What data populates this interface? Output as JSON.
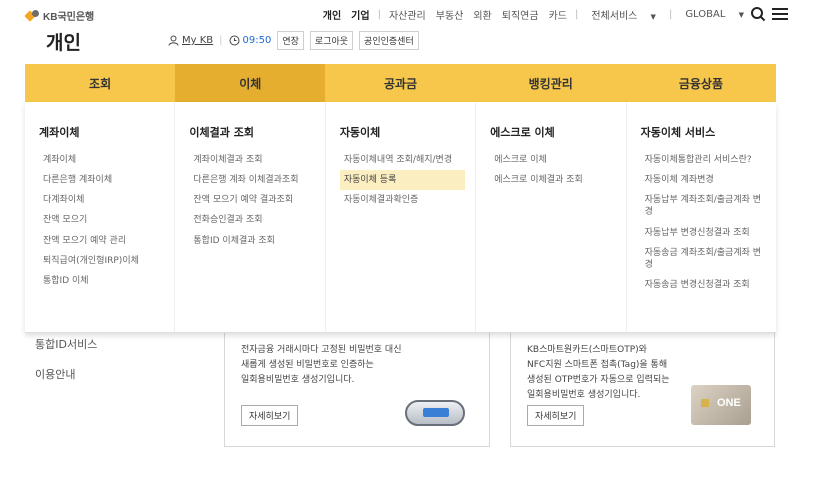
{
  "brand": {
    "name": "KB국민은행"
  },
  "page_heading": "개인",
  "topnav": {
    "items": [
      "개인",
      "기업",
      "자산관리",
      "부동산",
      "외환",
      "퇴직연금",
      "카드"
    ],
    "all_services": "전체서비스",
    "global": "GLOBAL"
  },
  "subbar": {
    "mykb": "My KB",
    "time": "09:50",
    "extend": "연장",
    "logout": "로그아웃",
    "cert_center": "공인인증센터"
  },
  "mainnav": {
    "tabs": [
      "조회",
      "이체",
      "공과금",
      "뱅킹관리",
      "금융상품"
    ],
    "active": "이체"
  },
  "mega": {
    "columns": [
      {
        "title": "계좌이체",
        "items": [
          "계좌이체",
          "다른은행 계좌이체",
          "다계좌이체",
          "잔액 모으기",
          "잔액 모으기 예약 관리",
          "퇴직급여(개인형IRP)이체",
          "통합ID 이체"
        ]
      },
      {
        "title": "이체결과 조회",
        "items": [
          "계좌이체결과 조회",
          "다른은행 계좌 이체결과조회",
          "잔액 모으기 예약 결과조회",
          "전화승인결과 조회",
          "통합ID 이체결과 조회"
        ]
      },
      {
        "title": "자동이체",
        "items": [
          "자동이체내역 조회/해지/변경",
          "자동이체 등록",
          "자동이체결과확인증"
        ],
        "highlight": "자동이체 등록"
      },
      {
        "title": "에스크로 이체",
        "items": [
          "에스크로 이체",
          "에스크로 이체결과 조회"
        ]
      },
      {
        "title": "자동이체 서비스",
        "items": [
          "자동이체통합관리 서비스란?",
          "자동이체 계좌변경",
          "자동납부 계좌조회/출금계좌 변경",
          "자동납부 변경신청결과 조회",
          "자동송금 계좌조회/출금계좌 변경",
          "자동송금 변경신청결과 조회"
        ]
      }
    ]
  },
  "sidebar": {
    "items": [
      "통합ID서비스",
      "이용안내"
    ]
  },
  "cards": [
    {
      "desc": [
        "전자금융 거래시마다 고정된 비밀번호 대신",
        "새롭게 생성된 비밀번호로 인증하는",
        "일회용비밀번호 생성기입니다."
      ],
      "more": "자세히보기"
    },
    {
      "desc": [
        "KB스마트원카드(스마트OTP)와",
        "NFC지원 스마트폰 접촉(Tag)을 통해",
        "생성된 OTP번호가 자동으로 입력되는",
        "일회용비밀번호 생성기입니다."
      ],
      "more": "자세히보기",
      "card_label": "ONE"
    }
  ],
  "colors": {
    "accent": "#f6c74a",
    "active_tab": "#e6ae2f",
    "link": "#1e6bd6"
  }
}
